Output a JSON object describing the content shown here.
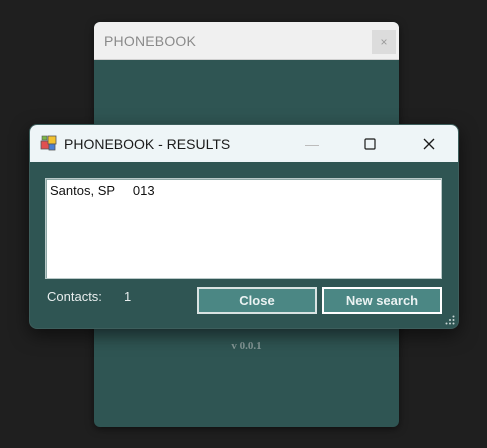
{
  "background_window": {
    "title": "PHONEBOOK",
    "close_glyph": "×",
    "version": "v 0.0.1"
  },
  "dialog": {
    "title": "PHONEBOOK - RESULTS",
    "icon": "app-icon",
    "minimize_glyph": "—",
    "maximize_glyph": "☐",
    "close_glyph": "✕",
    "results": [
      {
        "city": "Santos, SP",
        "code": "013"
      }
    ],
    "contacts_label": "Contacts:",
    "contacts_count": "1",
    "close_button": "Close",
    "new_search_button": "New search"
  },
  "colors": {
    "window_body": "#2f5553",
    "button_fill": "#4b8784",
    "titlebar_active": "#eef5f7",
    "titlebar_inactive": "#f0f0f0",
    "desktop": "#1f1f1f"
  }
}
